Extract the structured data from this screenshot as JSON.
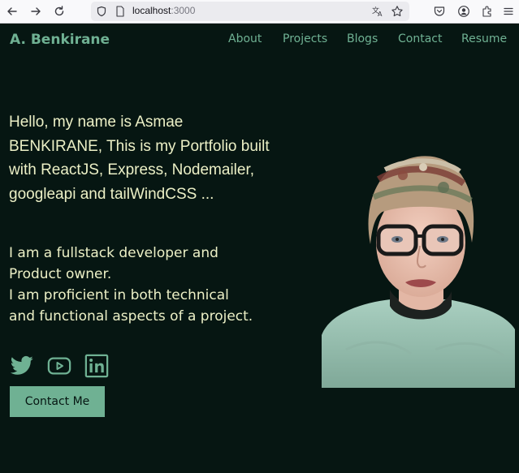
{
  "browser": {
    "url_host": "localhost",
    "url_port": ":3000"
  },
  "site": {
    "logo": "A. Benkirane",
    "nav": [
      {
        "label": "About"
      },
      {
        "label": "Projects"
      },
      {
        "label": "Blogs"
      },
      {
        "label": "Contact"
      },
      {
        "label": "Resume"
      }
    ],
    "hero": {
      "intro": "Hello, my name is Asmae BENKIRANE, This is my Portfolio built with ReactJS, Express, Nodemailer, googleapi and tailWindCSS ...",
      "desc_line1": "I am a fullstack developer and",
      "desc_line2": "Product owner.",
      "desc_line3": "I am proficient in both technical",
      "desc_line4": "and functional aspects of a project."
    },
    "social": [
      "twitter-icon",
      "youtube-icon",
      "linkedin-icon"
    ],
    "contact_button": "Contact Me"
  },
  "colors": {
    "background": "#061612",
    "accent": "#6fb193",
    "text": "#ecf0c6"
  }
}
